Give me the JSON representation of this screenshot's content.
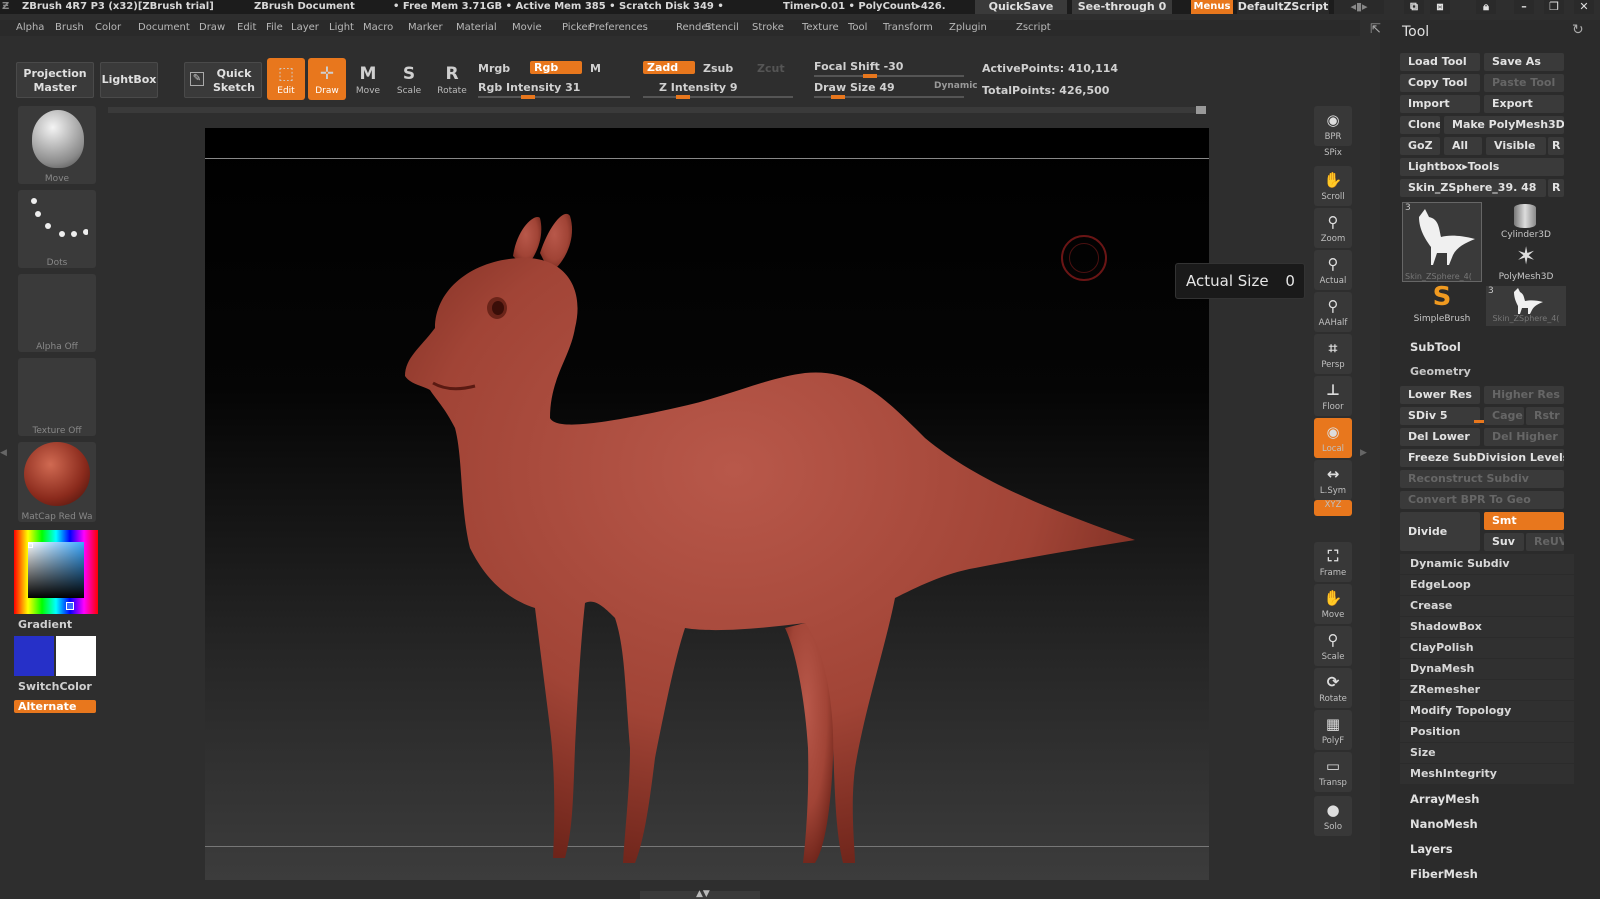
{
  "titlebar": {
    "app": "ZBrush 4R7 P3 (x32)[ZBrush trial]",
    "doc": "ZBrush Document",
    "free_mem": "• Free Mem 3.71GB • Active Mem 385 • Scratch Disk 349 •",
    "timer": "Timer▸0.01 • PolyCount▸426.",
    "quicksave": "QuickSave",
    "seethrough": "See-through  0",
    "menus": "Menus",
    "script": "DefaultZScript"
  },
  "menu": [
    "Alpha",
    "Brush",
    "Color",
    "Document",
    "Draw",
    "Edit",
    "File",
    "Layer",
    "Light",
    "Macro",
    "Marker",
    "Material",
    "Movie",
    "Picker",
    "Preferences",
    "Render",
    "Stencil",
    "Stroke",
    "Texture",
    "Tool",
    "Transform",
    "Zplugin",
    "Zscript"
  ],
  "shelf": {
    "projection_master": "Projection Master",
    "lightbox": "LightBox",
    "quick_sketch": "Quick Sketch",
    "edit": "Edit",
    "draw": "Draw",
    "move": "Move",
    "scale": "Scale",
    "rotate": "Rotate",
    "mrgb": "Mrgb",
    "rgb": "Rgb",
    "m": "M",
    "rgb_intensity": "Rgb Intensity 31",
    "zadd": "Zadd",
    "zsub": "Zsub",
    "zcut": "Zcut",
    "z_intensity": "Z Intensity 9",
    "focal_shift": "Focal Shift -30",
    "draw_size": "Draw Size 49",
    "dynamic": "Dynamic",
    "active_points": "ActivePoints: 410,114",
    "total_points": "TotalPoints: 426,500",
    "rgb_intensity_value": 31,
    "z_intensity_value": 9,
    "focal_shift_value": -30,
    "draw_size_value": 49
  },
  "left": {
    "brush": "Move",
    "stroke": "Dots",
    "alpha": "Alpha  Off",
    "texture": "Texture  Off",
    "material": "MatCap Red Wa",
    "gradient": "Gradient",
    "switchcolor": "SwitchColor",
    "alternate": "Alternate",
    "colors": {
      "primary": "#2630c8",
      "secondary": "#ffffff"
    }
  },
  "canvas": {
    "tooltip_label": "Actual Size",
    "tooltip_value": "0",
    "model_color": "#a8453a"
  },
  "rightcol": [
    "BPR",
    "SPix",
    "Scroll",
    "Zoom",
    "Actual",
    "AAHalf",
    "Persp",
    "Floor",
    "Local",
    "L.Sym",
    "XYZ",
    "Frame",
    "Move",
    "Scale",
    "Rotate",
    "PolyF",
    "Transp",
    "Solo"
  ],
  "tool": {
    "title": "Tool",
    "load": "Load Tool",
    "save": "Save As",
    "copy": "Copy Tool",
    "paste": "Paste Tool",
    "import": "Import",
    "export": "Export",
    "clone": "Clone",
    "make_poly": "Make PolyMesh3D",
    "goz": "GoZ",
    "all": "All",
    "visible": "Visible",
    "r": "R",
    "lightbox_tools": "Lightbox▸Tools",
    "current": "Skin_ZSphere_39. 48",
    "thumbs": [
      "Skin_ZSphere_4(",
      "Cylinder3D",
      "PolyMesh3D",
      "SimpleBrush",
      "Skin_ZSphere_4("
    ],
    "thumb_counts": [
      "3",
      "3"
    ],
    "subtool": "SubTool",
    "geometry": "Geometry",
    "lower_res": "Lower Res",
    "higher_res": "Higher Res",
    "sdiv": "SDiv 5",
    "cage": "Cage",
    "rstr": "Rstr",
    "del_lower": "Del Lower",
    "del_higher": "Del Higher",
    "freeze": "Freeze SubDivision Levels",
    "reconstruct": "Reconstruct Subdiv",
    "convert_bpr": "Convert BPR To Geo",
    "divide": "Divide",
    "smt": "Smt",
    "suv": "Suv",
    "reuv": "ReUV",
    "geo_items": [
      "Dynamic Subdiv",
      "EdgeLoop",
      "Crease",
      "ShadowBox",
      "ClayPolish",
      "DynaMesh",
      "ZRemesher",
      "Modify Topology",
      "Position",
      "Size",
      "MeshIntegrity"
    ],
    "sections": [
      "ArrayMesh",
      "NanoMesh",
      "Layers",
      "FiberMesh"
    ]
  }
}
